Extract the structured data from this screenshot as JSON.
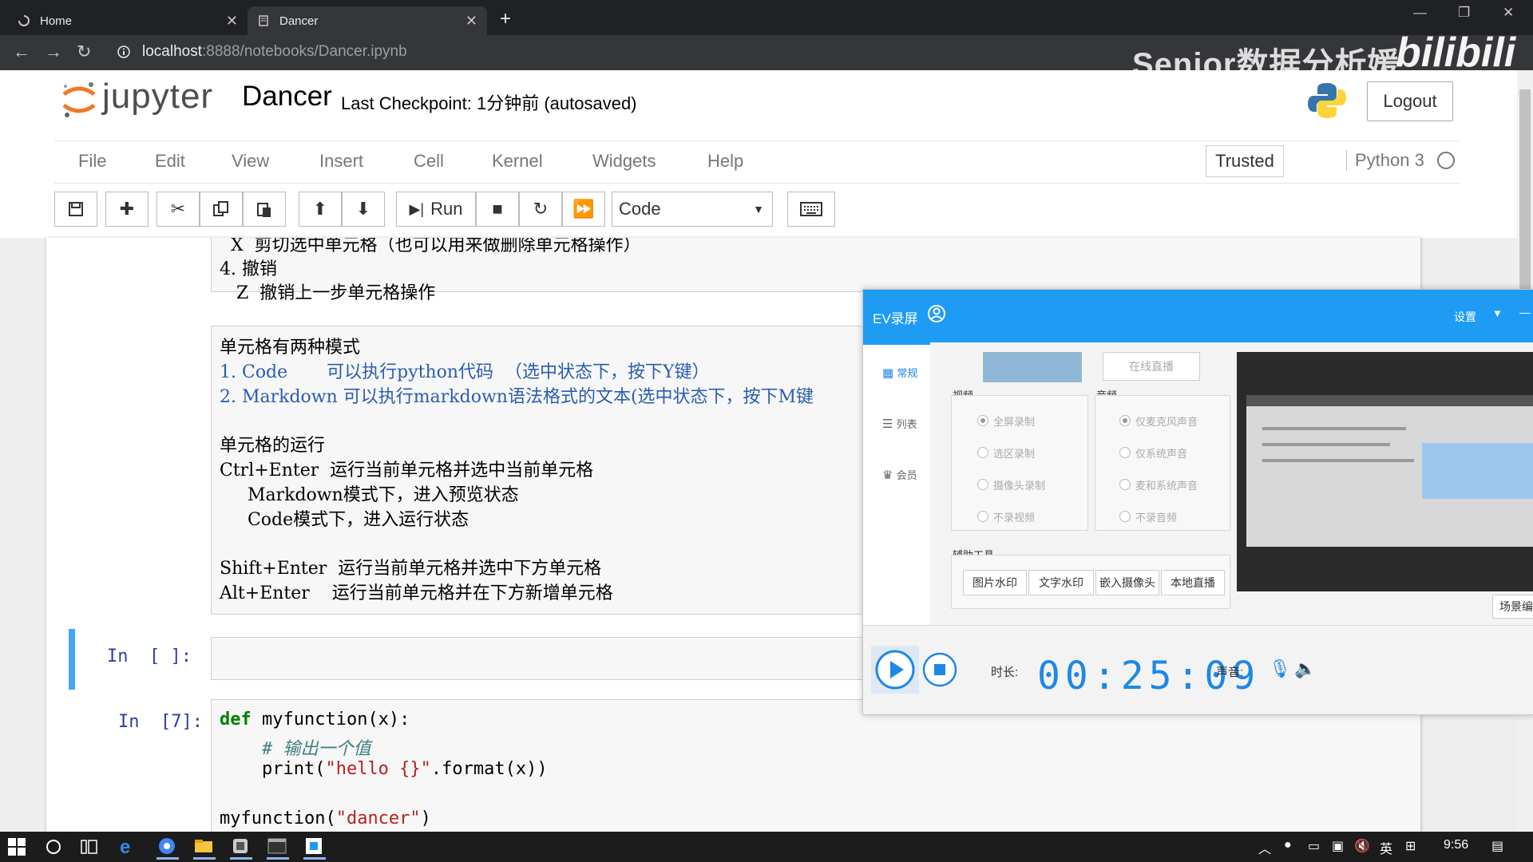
{
  "browser": {
    "tabs": [
      {
        "title": "Home",
        "active": false
      },
      {
        "title": "Dancer",
        "active": true
      }
    ],
    "url_host": "localhost",
    "url_path": ":8888/notebooks/Dancer.ipynb"
  },
  "watermark": {
    "text": "Senior数据分析媛",
    "site": "bilibili"
  },
  "jupyter": {
    "logo_text": "jupyter",
    "notebook_name": "Dancer",
    "checkpoint": "Last Checkpoint: 1分钟前   (autosaved)",
    "logout_label": "Logout",
    "menu": [
      "File",
      "Edit",
      "View",
      "Insert",
      "Cell",
      "Kernel",
      "Widgets",
      "Help"
    ],
    "trusted_label": "Trusted",
    "kernel_name": "Python 3",
    "toolbar": {
      "run_label": "Run",
      "cell_type": "Code"
    }
  },
  "notebook": {
    "markdown_cell_1": [
      "  X  剪切选中单元格（也可以用来做删除单元格操作）",
      "4. 撤销",
      "   Z  撤销上一步单元格操作"
    ],
    "markdown_cell_2": [
      "单元格有两种模式",
      "1. Code       可以执行python代码  （选中状态下，按下Y键）",
      "2. Markdown 可以执行markdown语法格式的文本(选中状态下，按下M键",
      "",
      "单元格的运行",
      "Ctrl+Enter  运行当前单元格并选中当前单元格",
      "     Markdown模式下，进入预览状态",
      "     Code模式下，进入运行状态",
      "",
      "Shift+Enter  运行当前单元格并选中下方单元格",
      "Alt+Enter    运行当前单元格并在下方新增单元格"
    ],
    "empty_cell_prompt": "In  [ ]:",
    "code_cell_prompt": "In  [7]:",
    "code_lines": [
      {
        "kw": "def",
        "rest": " myfunction(x):"
      },
      {
        "comment": "    # 输出一个值"
      },
      {
        "plain": "    print(",
        "str": "\"hello {}\"",
        "tail": ".format(x))"
      },
      {
        "plain": ""
      },
      {
        "plain": "myfunction(",
        "str": "\"dancer\"",
        "tail": ")"
      }
    ]
  },
  "ev_recorder": {
    "title": "EV录屏",
    "settings_label": "设置",
    "sidebar": [
      "常规",
      "列表",
      "会员"
    ],
    "live_btn": "在线直播",
    "video_group": "视频",
    "video_options": [
      "全屏录制",
      "选区录制",
      "摄像头录制",
      "不录视频"
    ],
    "audio_group": "音频",
    "audio_options": [
      "仅麦克风声音",
      "仅系统声音",
      "麦和系统声音",
      "不录音频"
    ],
    "tools_group": "辅助工具",
    "tools": [
      "图片水印",
      "文字水印",
      "嵌入摄像头",
      "本地直播"
    ],
    "scene_label": "场景编",
    "duration_label": "时长:",
    "duration": "00:25:09",
    "sound_label": "声音:",
    "accent": "#1e9cf4"
  },
  "taskbar": {
    "ime": "英",
    "time": "9:56"
  }
}
